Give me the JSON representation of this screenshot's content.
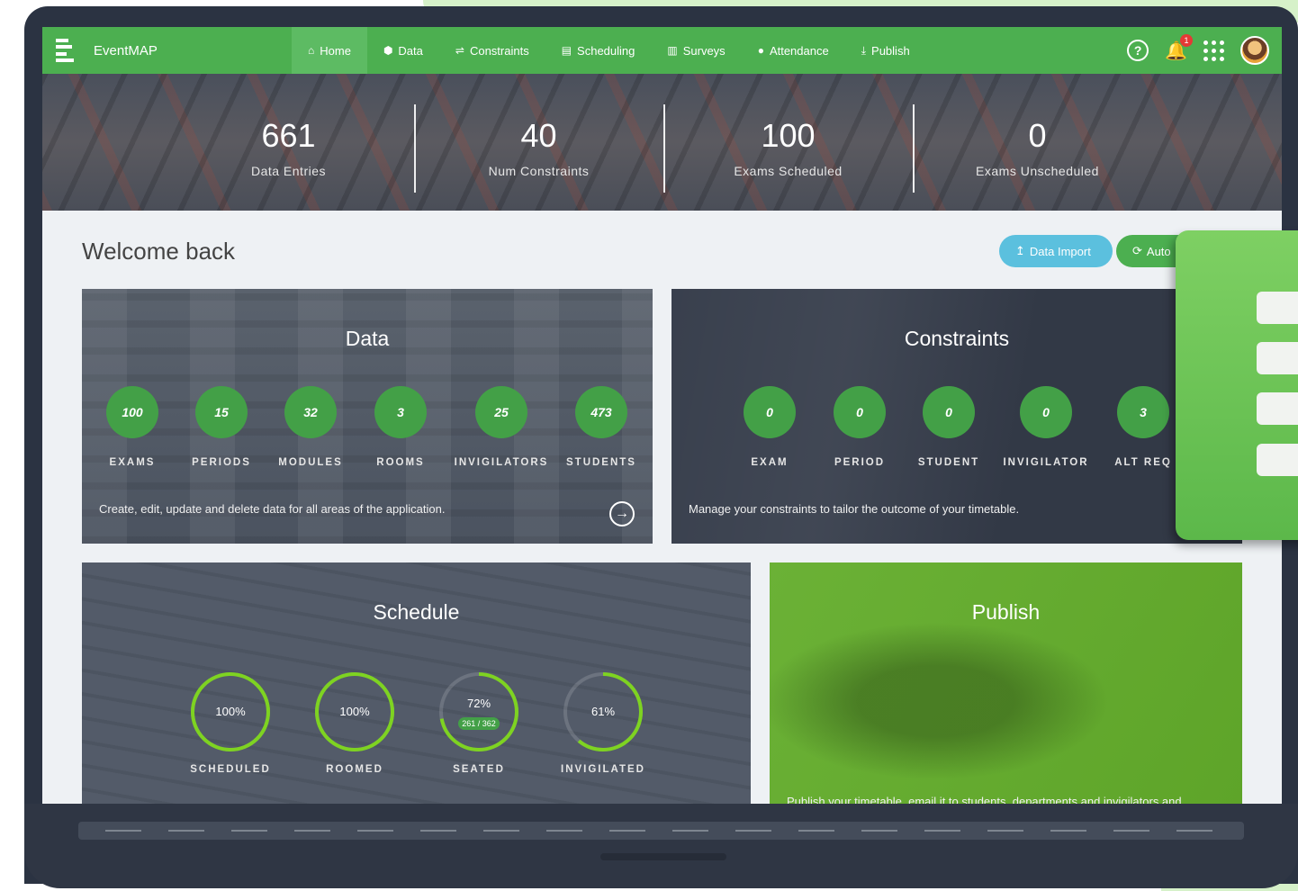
{
  "nav": {
    "brand": "EventMAP",
    "items": [
      {
        "label": "Home",
        "icon": "home-icon",
        "glyph": "⌂",
        "active": true
      },
      {
        "label": "Data",
        "icon": "database-icon",
        "glyph": "⬢"
      },
      {
        "label": "Constraints",
        "icon": "sliders-icon",
        "glyph": "⇌"
      },
      {
        "label": "Scheduling",
        "icon": "calendar-icon",
        "glyph": "▤"
      },
      {
        "label": "Surveys",
        "icon": "clipboard-icon",
        "glyph": "▥"
      },
      {
        "label": "Attendance",
        "icon": "user-icon",
        "glyph": "●"
      },
      {
        "label": "Publish",
        "icon": "download-icon",
        "glyph": "⤓"
      }
    ],
    "help": "?",
    "notifications": "1"
  },
  "stats": [
    {
      "value": "661",
      "label": "Data Entries"
    },
    {
      "value": "40",
      "label": "Num Constraints"
    },
    {
      "value": "100",
      "label": "Exams Scheduled"
    },
    {
      "value": "0",
      "label": "Exams Unscheduled"
    }
  ],
  "welcome": "Welcome back",
  "buttons": {
    "import": "Data Import",
    "auto": "Auto"
  },
  "data_card": {
    "title": "Data",
    "metrics": [
      {
        "value": "100",
        "label": "EXAMS"
      },
      {
        "value": "15",
        "label": "PERIODS"
      },
      {
        "value": "32",
        "label": "MODULES"
      },
      {
        "value": "3",
        "label": "ROOMS"
      },
      {
        "value": "25",
        "label": "INVIGILATORS"
      },
      {
        "value": "473",
        "label": "STUDENTS"
      }
    ],
    "description": "Create, edit, update and delete data for all areas of the application."
  },
  "constraints_card": {
    "title": "Constraints",
    "metrics": [
      {
        "value": "0",
        "label": "EXAM"
      },
      {
        "value": "0",
        "label": "PERIOD"
      },
      {
        "value": "0",
        "label": "STUDENT"
      },
      {
        "value": "0",
        "label": "INVIGILATOR"
      },
      {
        "value": "3",
        "label": "ALT REQ"
      }
    ],
    "description": "Manage your constraints to tailor the outcome of your timetable."
  },
  "schedule_card": {
    "title": "Schedule",
    "rings": [
      {
        "percent": "100%",
        "fraction": 1.0,
        "label": "SCHEDULED"
      },
      {
        "percent": "100%",
        "fraction": 1.0,
        "label": "ROOMED"
      },
      {
        "percent": "72%",
        "fraction": 0.72,
        "label": "SEATED",
        "detail": "261 / 362"
      },
      {
        "percent": "61%",
        "fraction": 0.61,
        "label": "INVIGILATED"
      }
    ]
  },
  "publish_card": {
    "title": "Publish",
    "description": "Publish your timetable, email it to students, departments and invigilators and"
  }
}
